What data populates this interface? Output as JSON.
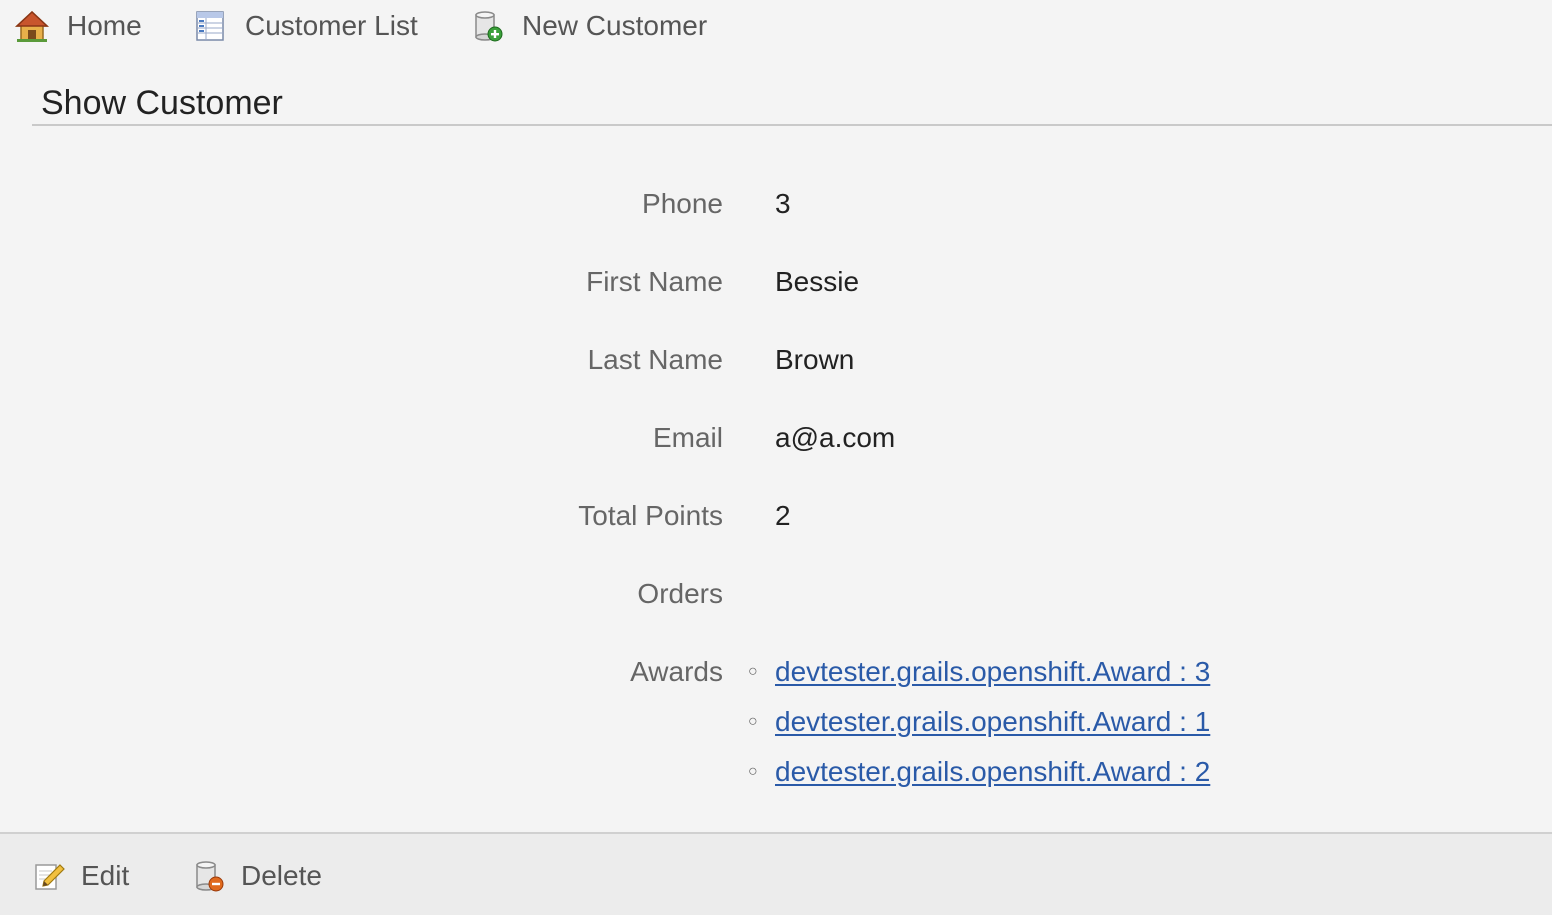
{
  "nav": {
    "home": {
      "label": "Home",
      "icon": "home-icon"
    },
    "list": {
      "label": "Customer List",
      "icon": "table-list-icon"
    },
    "create": {
      "label": "New Customer",
      "icon": "database-add-icon"
    }
  },
  "page": {
    "title": "Show Customer"
  },
  "customer": {
    "fields": [
      {
        "label": "Phone",
        "value": "3"
      },
      {
        "label": "First Name",
        "value": "Bessie"
      },
      {
        "label": "Last Name",
        "value": "Brown"
      },
      {
        "label": "Email",
        "value": "a@a.com"
      },
      {
        "label": "Total Points",
        "value": "2"
      },
      {
        "label": "Orders",
        "value": ""
      },
      {
        "label": "Awards"
      }
    ],
    "awards": [
      "devtester.grails.openshift.Award : 3",
      "devtester.grails.openshift.Award : 1",
      "devtester.grails.openshift.Award : 2"
    ]
  },
  "buttons": {
    "edit": {
      "label": "Edit",
      "icon": "edit-pencil-icon"
    },
    "delete": {
      "label": "Delete",
      "icon": "database-delete-icon"
    }
  },
  "colors": {
    "link": "#2a5aa8",
    "background": "#f4f4f4",
    "button_bar": "#ececec"
  }
}
